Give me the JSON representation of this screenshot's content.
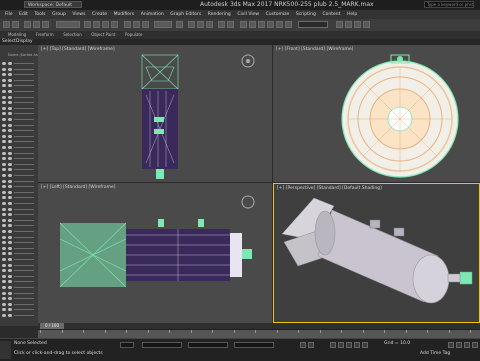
{
  "window": {
    "title": "Autodesk 3ds Max 2017     NRK500-255 plub 2.5_MARK.max",
    "workspace": "Workspace: Default",
    "search_placeholder": "Type a keyword or phrase"
  },
  "menu": [
    "File",
    "Edit",
    "Tools",
    "Group",
    "Views",
    "Create",
    "Modifiers",
    "Animation",
    "Graph Editors",
    "Rendering",
    "Civil View",
    "Customize",
    "Scripting",
    "Content",
    "Help"
  ],
  "ribbon": [
    "Modeling",
    "Freeform",
    "Selection",
    "Object Paint",
    "Populate"
  ],
  "left_tabs": {
    "select": "Select",
    "display": "Display"
  },
  "sidebar": {
    "sort_label": "Name (Sorted Ascending)"
  },
  "viewports": {
    "top": "[+] [Top] [Standard] [Wireframe]",
    "front": "[+] [Front] [Standard] [Wireframe]",
    "left": "[+] [Left] [Standard] [Wireframe]",
    "perspective": "[+] [Perspective] [Standard] [Default Shading]"
  },
  "timeline": {
    "frame": "0 / 100"
  },
  "status": {
    "selection": "None Selected",
    "hint": "Click or click-and-drag to select objects",
    "grid": "Grid = 10.0",
    "time_tag": "Add Time Tag"
  },
  "colors": {
    "wire_green": "#7de8b3",
    "wire_purple": "#3a2a5c",
    "active_viewport": "#f0c400",
    "mesh_light": "#c9c4cf"
  }
}
